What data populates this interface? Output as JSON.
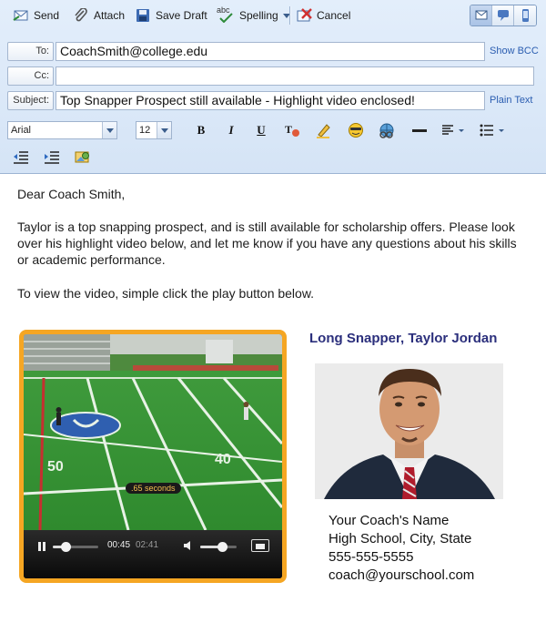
{
  "toolbar": {
    "send_label": "Send",
    "attach_label": "Attach",
    "save_draft_label": "Save Draft",
    "spelling_label": "Spelling",
    "spelling_icon_text": "abc",
    "cancel_label": "Cancel"
  },
  "fields": {
    "to": {
      "label": "To:",
      "value": "CoachSmith@college.edu"
    },
    "cc": {
      "label": "Cc:",
      "value": ""
    },
    "subject": {
      "label": "Subject:",
      "value": "Top Snapper Prospect still available - Highlight video enclosed!"
    },
    "show_bcc": "Show BCC",
    "plain_text": "Plain Text"
  },
  "format": {
    "font": "Arial",
    "size": "12",
    "bold": "B",
    "italic": "I",
    "underline": "U"
  },
  "message": {
    "greeting": "Dear Coach Smith,",
    "para1_line1": "Taylor is a top snapping prospect, and is still available for scholarship offers. Please look",
    "para1_line2": "over his highlight video below, and let me know if you have any questions about his skills",
    "para1_line3": "or academic performance.",
    "para2": "To view the video, simple click the play button below."
  },
  "video": {
    "overlay": ".65 seconds",
    "current_time": "00:45",
    "duration": "02:41",
    "progress_fraction": 0.28,
    "volume_fraction": 0.6
  },
  "profile": {
    "title": "Long Snapper, Taylor Jordan",
    "coach_name": "Your Coach's Name",
    "school": "High School, City, State",
    "phone": "555-555-5555",
    "email": "coach@yourschool.com"
  },
  "colors": {
    "accent_link": "#2a5db0",
    "video_border": "#f5a623",
    "profile_title": "#2b2f7c"
  }
}
